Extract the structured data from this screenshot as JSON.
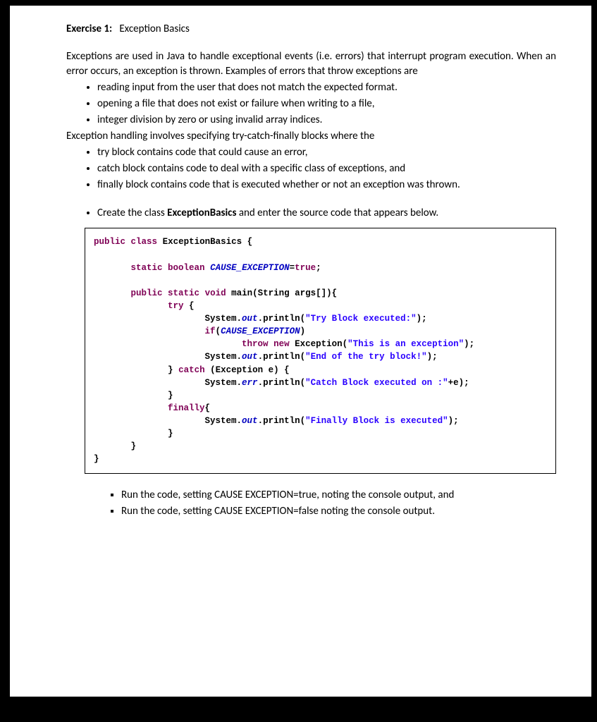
{
  "title_label": "Exercise 1:",
  "title_text": "Exception Basics",
  "intro": "Exceptions are used in Java to handle exceptional events (i.e. errors) that interrupt program execution. When an error occurs, an exception is thrown. Examples of errors that throw exceptions are",
  "examples": [
    "reading input from the user that does not match the expected format.",
    "opening a file that does not exist or failure when writing to a file,",
    "integer division by zero or using invalid array indices."
  ],
  "handling_intro": "Exception handling involves specifying try-catch-finally blocks where the",
  "blocks": [
    "try block contains code that could cause an error,",
    "catch block contains code to deal with a specific class of exceptions, and",
    "finally block contains code that is executed whether or not an exception was thrown."
  ],
  "create_pre": "Create the class ",
  "create_bold": "ExceptionBasics",
  "create_post": " and enter the source code that appears below.",
  "code": {
    "kw_public": "public",
    "kw_class": "class",
    "cls": "ExceptionBasics {",
    "kw_static": "static",
    "kw_boolean": "boolean",
    "var_cause": "CAUSE_EXCEPTION",
    "eq_true": "=",
    "kw_true": "true",
    "semi": ";",
    "kw_void": "void",
    "main": "main(String args[]){",
    "kw_try": "try",
    "brace_open": " {",
    "sys_out": "System.",
    "out": "out",
    "println": ".println(",
    "s_try": "\"Try Block executed:\"",
    "close_stmt": ");",
    "kw_if": "if",
    "if_cond_open": "(",
    "if_cond_close": ")",
    "kw_throw": "throw",
    "kw_new": "new",
    "exc": "Exception(",
    "s_exc": "\"This is an exception\"",
    "s_end": "\"End of the try block!\"",
    "brace_close": "}",
    "kw_catch": "catch",
    "catch_decl": " (Exception e) {",
    "sys_err": "System.",
    "err": "err",
    "s_catch": "\"Catch Block executed on :\"",
    "plus_e": "+e);",
    "kw_finally": "finally",
    "finally_brace": "{",
    "s_finally": "\"Finally Block is executed\""
  },
  "run1": "Run the code, setting CAUSE EXCEPTION=true, noting the console output, and",
  "run2": "Run the code, setting CAUSE EXCEPTION=false noting the console output."
}
